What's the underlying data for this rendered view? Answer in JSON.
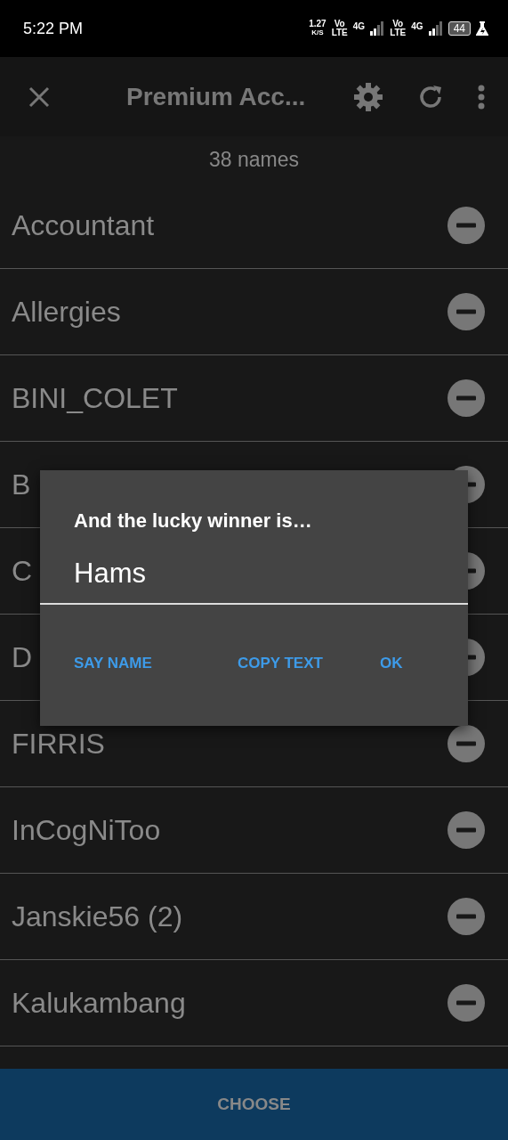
{
  "status_bar": {
    "time": "5:22 PM",
    "net_speed": "1.27",
    "net_unit": "K/S",
    "sims": [
      {
        "volte_top": "Vo",
        "volte_bottom": "LTE",
        "network": "4G"
      },
      {
        "volte_top": "Vo",
        "volte_bottom": "LTE",
        "network": "4G"
      }
    ],
    "battery": "44"
  },
  "app_bar": {
    "title": "Premium Acc..."
  },
  "count": "38 names",
  "names": [
    {
      "name": "Accountant"
    },
    {
      "name": "Allergies"
    },
    {
      "name": "BINI_COLET"
    },
    {
      "name": "B"
    },
    {
      "name": "C"
    },
    {
      "name": "D"
    },
    {
      "name": "FIRRIS"
    },
    {
      "name": "InCogNiToo"
    },
    {
      "name": "Janskie56 (2)"
    },
    {
      "name": "Kalukambang"
    }
  ],
  "dialog": {
    "title": "And the lucky winner is…",
    "value": "Hams",
    "buttons": [
      "SAY NAME",
      "COPY TEXT",
      "OK"
    ]
  },
  "choose_button": "CHOOSE"
}
